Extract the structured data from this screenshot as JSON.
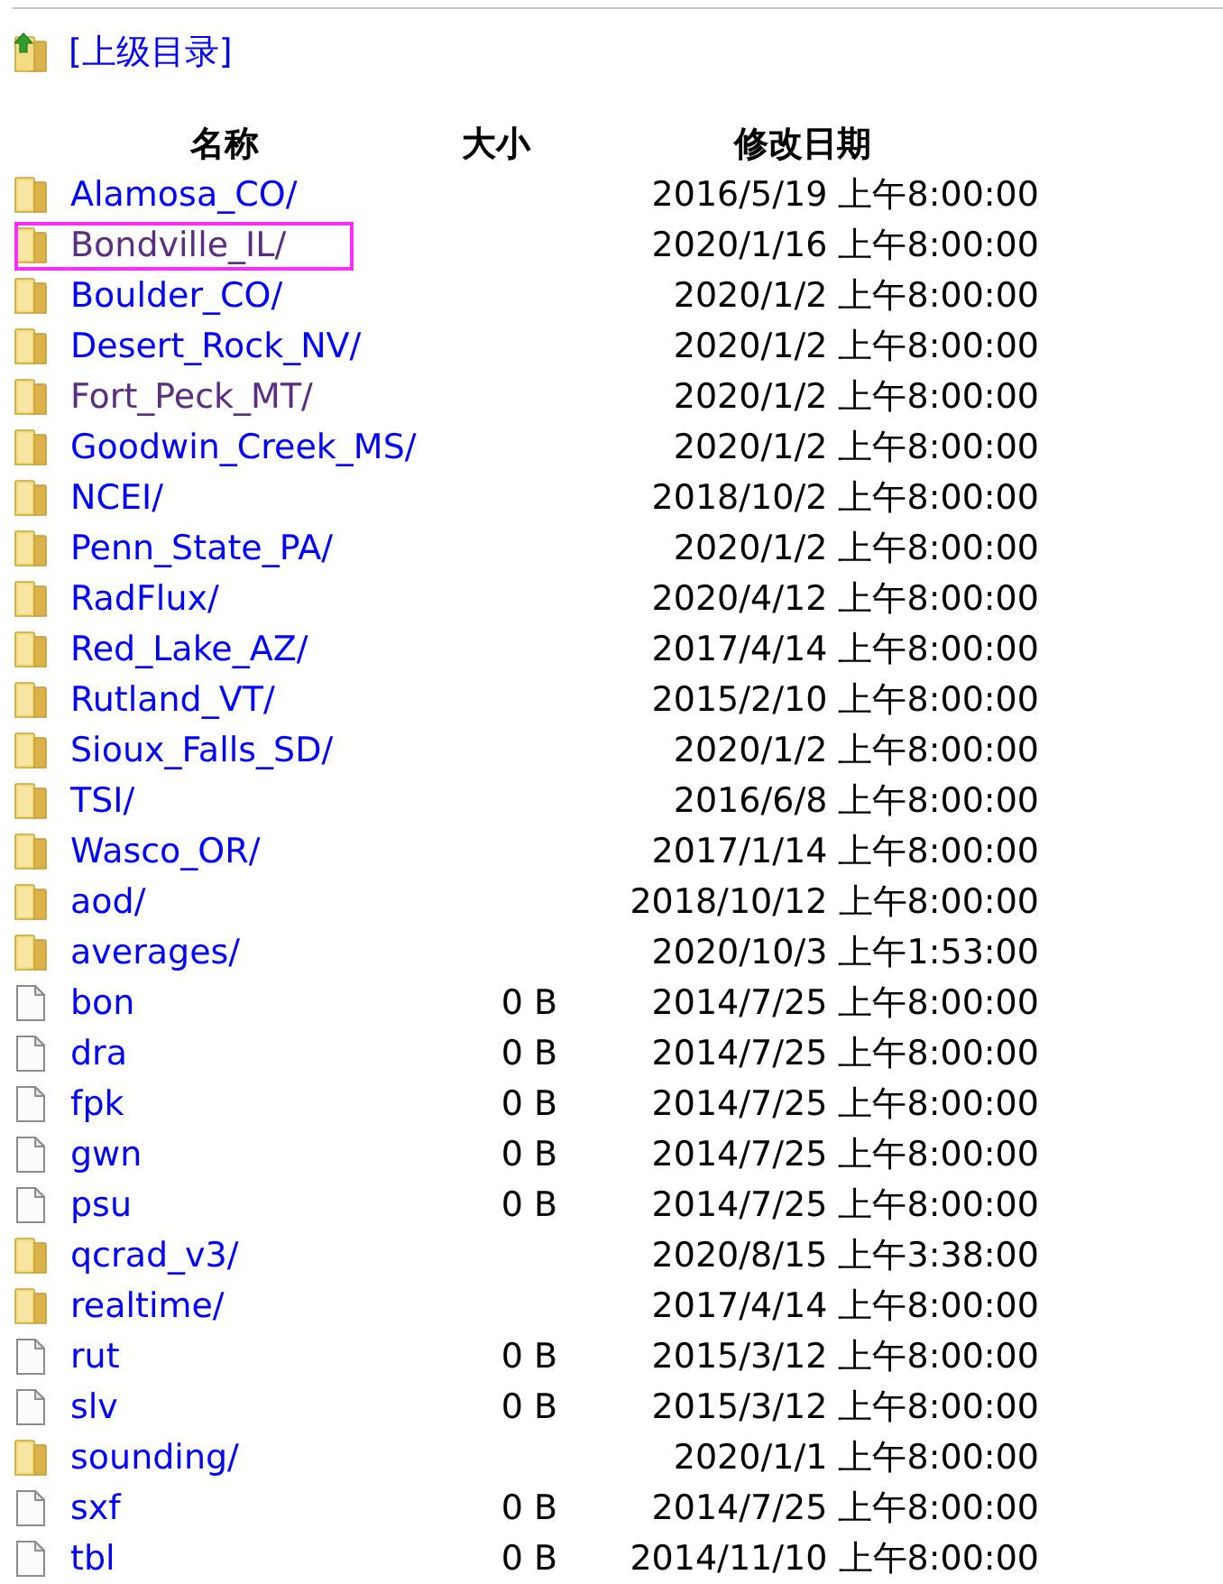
{
  "parent_link": {
    "label": "[上级目录]"
  },
  "table": {
    "columns": [
      "名称",
      "大小",
      "修改日期"
    ],
    "rows": [
      {
        "kind": "folder",
        "name": "Alamosa_CO/",
        "date": "2016/5/19 上午8:00:00",
        "visited": false,
        "highlighted": false
      },
      {
        "kind": "folder",
        "name": "Bondville_IL/",
        "date": "2020/1/16 上午8:00:00",
        "visited": true,
        "highlighted": true
      },
      {
        "kind": "folder",
        "name": "Boulder_CO/",
        "date": "2020/1/2 上午8:00:00",
        "visited": false,
        "highlighted": false
      },
      {
        "kind": "folder",
        "name": "Desert_Rock_NV/",
        "date": "2020/1/2 上午8:00:00",
        "visited": false,
        "highlighted": false
      },
      {
        "kind": "folder",
        "name": "Fort_Peck_MT/",
        "date": "2020/1/2 上午8:00:00",
        "visited": true,
        "highlighted": false
      },
      {
        "kind": "folder",
        "name": "Goodwin_Creek_MS/",
        "date": "2020/1/2 上午8:00:00",
        "visited": false,
        "highlighted": false
      },
      {
        "kind": "folder",
        "name": "NCEI/",
        "date": "2018/10/2 上午8:00:00",
        "visited": false,
        "highlighted": false
      },
      {
        "kind": "folder",
        "name": "Penn_State_PA/",
        "date": "2020/1/2 上午8:00:00",
        "visited": false,
        "highlighted": false
      },
      {
        "kind": "folder",
        "name": "RadFlux/",
        "date": "2020/4/12 上午8:00:00",
        "visited": false,
        "highlighted": false
      },
      {
        "kind": "folder",
        "name": "Red_Lake_AZ/",
        "date": "2017/4/14 上午8:00:00",
        "visited": false,
        "highlighted": false
      },
      {
        "kind": "folder",
        "name": "Rutland_VT/",
        "date": "2015/2/10 上午8:00:00",
        "visited": false,
        "highlighted": false
      },
      {
        "kind": "folder",
        "name": "Sioux_Falls_SD/",
        "date": "2020/1/2 上午8:00:00",
        "visited": false,
        "highlighted": false
      },
      {
        "kind": "folder",
        "name": "TSI/",
        "date": "2016/6/8 上午8:00:00",
        "visited": false,
        "highlighted": false
      },
      {
        "kind": "folder",
        "name": "Wasco_OR/",
        "date": "2017/1/14 上午8:00:00",
        "visited": false,
        "highlighted": false
      },
      {
        "kind": "folder",
        "name": "aod/",
        "date": "2018/10/12 上午8:00:00",
        "visited": false,
        "highlighted": false
      },
      {
        "kind": "folder",
        "name": "averages/",
        "date": "2020/10/3 上午1:53:00",
        "visited": false,
        "highlighted": false
      },
      {
        "kind": "file",
        "name": "bon",
        "size": "0 B",
        "date": "2014/7/25 上午8:00:00",
        "visited": false,
        "highlighted": false
      },
      {
        "kind": "file",
        "name": "dra",
        "size": "0 B",
        "date": "2014/7/25 上午8:00:00",
        "visited": false,
        "highlighted": false
      },
      {
        "kind": "file",
        "name": "fpk",
        "size": "0 B",
        "date": "2014/7/25 上午8:00:00",
        "visited": false,
        "highlighted": false
      },
      {
        "kind": "file",
        "name": "gwn",
        "size": "0 B",
        "date": "2014/7/25 上午8:00:00",
        "visited": false,
        "highlighted": false
      },
      {
        "kind": "file",
        "name": "psu",
        "size": "0 B",
        "date": "2014/7/25 上午8:00:00",
        "visited": false,
        "highlighted": false
      },
      {
        "kind": "folder",
        "name": "qcrad_v3/",
        "date": "2020/8/15 上午3:38:00",
        "visited": false,
        "highlighted": false
      },
      {
        "kind": "folder",
        "name": "realtime/",
        "date": "2017/4/14 上午8:00:00",
        "visited": false,
        "highlighted": false
      },
      {
        "kind": "file",
        "name": "rut",
        "size": "0 B",
        "date": "2015/3/12 上午8:00:00",
        "visited": false,
        "highlighted": false
      },
      {
        "kind": "file",
        "name": "slv",
        "size": "0 B",
        "date": "2015/3/12 上午8:00:00",
        "visited": false,
        "highlighted": false
      },
      {
        "kind": "folder",
        "name": "sounding/",
        "date": "2020/1/1 上午8:00:00",
        "visited": false,
        "highlighted": false
      },
      {
        "kind": "file",
        "name": "sxf",
        "size": "0 B",
        "date": "2014/7/25 上午8:00:00",
        "visited": false,
        "highlighted": false
      },
      {
        "kind": "file",
        "name": "tbl",
        "size": "0 B",
        "date": "2014/11/10 上午8:00:00",
        "visited": false,
        "highlighted": false
      }
    ]
  }
}
